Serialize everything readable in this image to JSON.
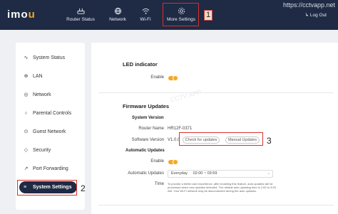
{
  "header": {
    "logo_text": "imo",
    "logo_dot": "u",
    "watermark_url": "https://cctvapp.net",
    "nav": [
      {
        "label": "Router Status",
        "icon": "router-icon"
      },
      {
        "label": "Network",
        "icon": "globe-icon"
      },
      {
        "label": "Wi-Fi",
        "icon": "wifi-icon"
      },
      {
        "label": "More Settings",
        "icon": "gear-icon"
      }
    ],
    "logout_label": "Log Out"
  },
  "annotations": {
    "one": "1",
    "two": "2",
    "three": "3"
  },
  "sidebar": {
    "items": [
      {
        "label": "System Status",
        "icon": "pulse-icon"
      },
      {
        "label": "LAN",
        "icon": "globe-icon"
      },
      {
        "label": "Network",
        "icon": "network-icon"
      },
      {
        "label": "Parental Controls",
        "icon": "shield-icon"
      },
      {
        "label": "Guest Network",
        "icon": "user-icon"
      },
      {
        "label": "Security",
        "icon": "lock-icon"
      },
      {
        "label": "Port Forwarding",
        "icon": "arrow-icon"
      },
      {
        "label": "System Settings",
        "icon": "settings-icon"
      }
    ]
  },
  "led": {
    "title": "LED indicator",
    "enable_label": "Enable",
    "enabled": true
  },
  "firmware": {
    "title": "Firmware Updates",
    "system_version_title": "System Version",
    "router_name_label": "Router Name",
    "router_name_value": "HR12F-0371",
    "software_version_label": "Software Version",
    "software_version_value": "V1.0.0",
    "check_button": "Check for updates",
    "manual_button": "Manual Updates",
    "auto_title": "Automatic Updates",
    "auto_enable_label": "Enable",
    "auto_enabled": true,
    "auto_updates_label": "Automatic Updates",
    "auto_updates_value": "Everyday",
    "auto_time_value": "02:00 ~ 03:59",
    "time_label": "Time",
    "time_note": "To provide a better user experience, after enabling this feature, auto updates will be processed when new updates detected. The default auto updating time is 2:00 to 3:59 AM. Your Wi-Fi network may be disconnected during the auto updates."
  },
  "watermark": "CCTV APP",
  "colors": {
    "header_bg": "#1f2a44",
    "accent": "#f5a623",
    "highlight": "#d9302c"
  }
}
